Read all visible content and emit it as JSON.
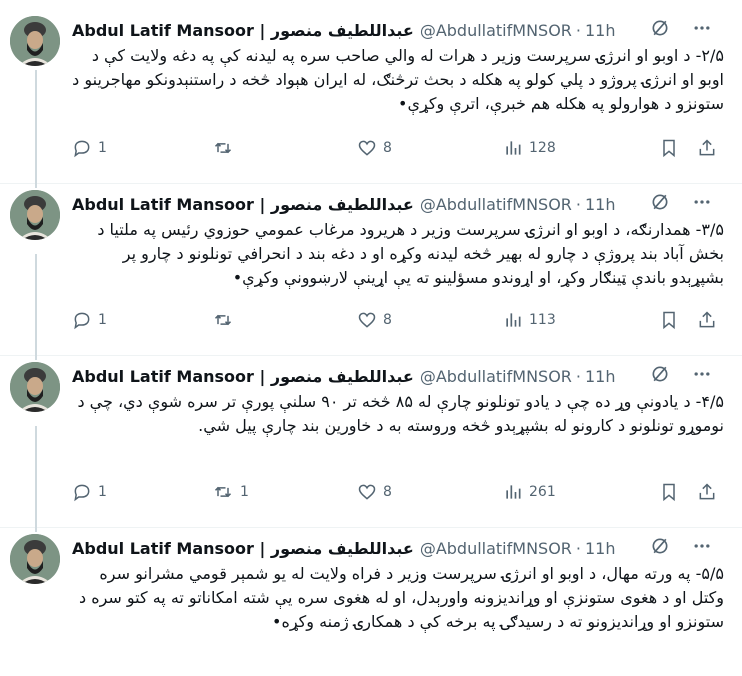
{
  "tweets": [
    {
      "name": "Abdul Latif Mansoor | عبداللطيف منصور",
      "handle": "@AbdullatifMNSOR",
      "time": "11h",
      "text": "۲/۵- د اوبو او انرژۍ سرپرست وزیر د هرات له والي صاحب سره په لیدنه کې په دغه ولایت کې د اوبو او انرژۍ پروژو د پلي کولو په هکله د بحث ترڅنګ، له ایران هېواد څخه د راستنېدونکو مهاجرینو د ستونزو د هوارولو په هکله هم خبرې، اترې وکړې•",
      "replies": "1",
      "retweets": "",
      "likes": "8",
      "views": "128"
    },
    {
      "name": "Abdul Latif Mansoor | عبداللطيف منصور",
      "handle": "@AbdullatifMNSOR",
      "time": "11h",
      "text": "۳/۵- همدارنګه، د اوبو او انرژۍ سرپرست وزیر د هریرود مرغاب عمومي حوزوي رئیس په ملتیا د بخش آباد بند پروژې د چارو له بهیر څخه لیدنه وکړه او د دغه بند د انحرافي تونلونو د چارو پر بشپړېدو باندې ټینګار وکړ، او اړوندو مسؤلینو ته یې اړینې لارښوونې وکړې•",
      "replies": "1",
      "retweets": "",
      "likes": "8",
      "views": "113"
    },
    {
      "name": "Abdul Latif Mansoor | عبداللطيف منصور",
      "handle": "@AbdullatifMNSOR",
      "time": "11h",
      "text": "۴/۵- د یادونې وړ ده چې د یادو تونلونو چارې له ۸۵ څخه تر ۹۰ سلنې پورې تر سره شوې دي، چې د نوموړو تونلونو د کارونو له بشپړېدو څخه وروسته به د خاورین بند چارې پیل شي.",
      "replies": "1",
      "retweets": "1",
      "likes": "8",
      "views": "261"
    },
    {
      "name": "Abdul Latif Mansoor | عبداللطيف منصور",
      "handle": "@AbdullatifMNSOR",
      "time": "11h",
      "text": "۵/۵- په ورته مهال، د اوبو او انرژۍ سرپرست وزیر د فراه ولایت له یو شمېر قومي مشرانو سره وکتل او د هغوی ستونزې او وړاندیزونه واورېدل، او له هغوی سره یې شته امکاناتو ته په کتو سره د ستونزو او وړاندیزونو ته د رسیدګۍ په برخه کې د همکارۍ ژمنه وکړه•"
    }
  ]
}
